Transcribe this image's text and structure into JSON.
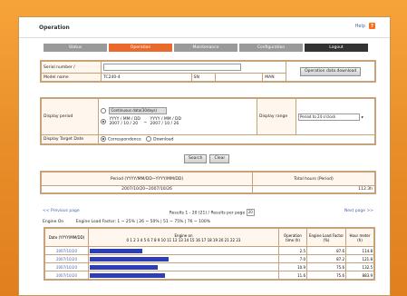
{
  "window": {
    "title": "Operation",
    "help_label": "Help"
  },
  "tabs": [
    {
      "label": "Status"
    },
    {
      "label": "Operation"
    },
    {
      "label": "Maintenance"
    },
    {
      "label": "Configuration"
    },
    {
      "label": "Logout"
    }
  ],
  "search": {
    "serial_label": "Serial number /",
    "model_label": "Model name",
    "model_value": "TC240-4",
    "field_a_label": "SN",
    "field_b_label": "MAN",
    "download_button": "Operation data download"
  },
  "period": {
    "label": "Display period",
    "option1": "Continuous data(30days)",
    "from_label": "YYYY / MM / DD",
    "from_value": "2007 / 10 / 20",
    "to_label": "YYYY / MM / DD",
    "to_value": "2007 / 10 / 26",
    "range_label": "Display range",
    "range_value": "Period to 24 o'clock"
  },
  "target": {
    "label": "Display Target Date",
    "opt_correspondence": "Correspondence",
    "opt_download": "Download"
  },
  "buttons": {
    "search": "Search",
    "clear": "Clear"
  },
  "summary": {
    "period_header": "Period (YYYY/MM/DD~YYYY/MM/DD)",
    "total_header": "Total hours (Period)",
    "period_value": "2007/10/20~2007/10/26",
    "total_value": "112.3h"
  },
  "nav": {
    "prev": "<< Previous page",
    "results": "Results 1 - 20 (21) / Results per page",
    "per_page": "20",
    "next": "Next page >>"
  },
  "legend": {
    "engine_on": "Engine On",
    "load_label": "Engine Load Factor: 1 ~ 25% | 26 ~ 50% | 51 ~ 75% | 76 ~ 100%"
  },
  "table": {
    "headers": [
      "Date (YYYY/MM/DD)",
      "Engine on",
      "Operation time (h)",
      "Engine Load Factor (%)",
      "Hour meter (h)"
    ],
    "hours_axis": "0 1 2 3 4 5 6 7 8 9 10 11 12 13 14 15 16 17 18 19 20 21 22 23",
    "rows": [
      {
        "date": "2007/10/20",
        "bar": 0.28,
        "op": "2.5",
        "load": "87.6",
        "meter": "114.8"
      },
      {
        "date": "2007/10/20",
        "bar": 0.42,
        "op": "7.0",
        "load": "87.2",
        "meter": "121.8"
      },
      {
        "date": "2007/10/20",
        "bar": 0.36,
        "op": "10.9",
        "load": "75.6",
        "meter": "132.5"
      },
      {
        "date": "2007/10/20",
        "bar": 0.4,
        "op": "11.6",
        "load": "75.6",
        "meter": "883.9"
      }
    ]
  },
  "colors": {
    "accent": "#e96a2c",
    "frame": "#f2982f",
    "bar": "#2d3fb8"
  }
}
